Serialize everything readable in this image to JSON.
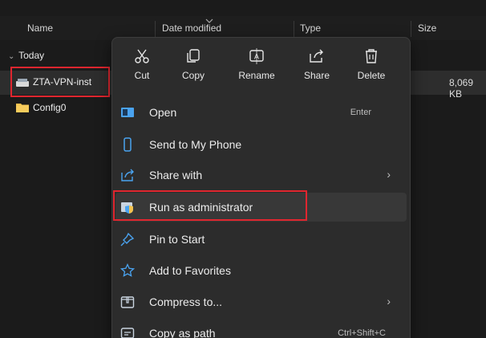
{
  "columns": {
    "name": "Name",
    "date_modified": "Date modified",
    "type": "Type",
    "size": "Size"
  },
  "group": {
    "label": "Today"
  },
  "files": [
    {
      "name": "ZTA-VPN-inst",
      "icon": "installer-file-icon",
      "size": "8,069 KB",
      "selected": true
    },
    {
      "name": "Config0",
      "icon": "folder-icon",
      "size": "",
      "selected": false
    }
  ],
  "context_menu": {
    "quick_actions": [
      {
        "label": "Cut",
        "icon": "cut-icon"
      },
      {
        "label": "Copy",
        "icon": "copy-icon"
      },
      {
        "label": "Rename",
        "icon": "rename-icon"
      },
      {
        "label": "Share",
        "icon": "share-icon"
      },
      {
        "label": "Delete",
        "icon": "delete-icon"
      }
    ],
    "items": [
      {
        "label": "Open",
        "icon": "open-app-icon",
        "shortcut": "Enter",
        "submenu": false
      },
      {
        "label": "Send to My Phone",
        "icon": "phone-icon",
        "shortcut": "",
        "submenu": false
      },
      {
        "label": "Share with",
        "icon": "share-with-icon",
        "shortcut": "",
        "submenu": true
      },
      {
        "label": "Run as administrator",
        "icon": "shield-admin-icon",
        "shortcut": "",
        "submenu": false,
        "highlighted": true
      },
      {
        "label": "Pin to Start",
        "icon": "pin-icon",
        "shortcut": "",
        "submenu": false
      },
      {
        "label": "Add to Favorites",
        "icon": "star-icon",
        "shortcut": "",
        "submenu": false
      },
      {
        "label": "Compress to...",
        "icon": "compress-icon",
        "shortcut": "",
        "submenu": true
      },
      {
        "label": "Copy as path",
        "icon": "copy-path-icon",
        "shortcut": "Ctrl+Shift+C",
        "submenu": false
      }
    ]
  },
  "colors": {
    "background": "#1b1b1b",
    "menu_bg": "#2c2c2c",
    "highlight_border": "#e0262f",
    "accent_blue": "#4aa3f0",
    "folder_yellow": "#f2c14e"
  }
}
